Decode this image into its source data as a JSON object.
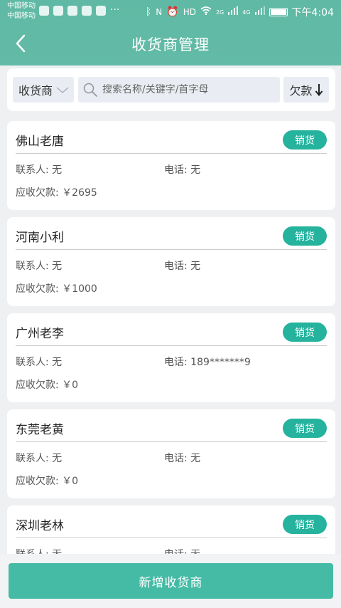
{
  "status_bar": {
    "carrier_1": "中国移动",
    "carrier_2": "中国移动",
    "hd": "HD",
    "net_2g": "2G",
    "net_4g": "4G",
    "time": "下午4:04"
  },
  "header": {
    "title": "收货商管理"
  },
  "search": {
    "filter_label": "收货商",
    "placeholder": "搜索名称/关键字/首字母",
    "sort_label": "欠款"
  },
  "labels": {
    "contact": "联系人:",
    "phone": "电话:",
    "receivable": "应收欠款:"
  },
  "customers": [
    {
      "name": "佛山老唐",
      "action": "销货",
      "contact": "无",
      "phone": "无",
      "receivable": "￥2695"
    },
    {
      "name": "河南小利",
      "action": "销货",
      "contact": "无",
      "phone": "无",
      "receivable": "￥1000"
    },
    {
      "name": "广州老李",
      "action": "销货",
      "contact": "无",
      "phone": "189*******9",
      "receivable": "￥0"
    },
    {
      "name": "东莞老黄",
      "action": "销货",
      "contact": "无",
      "phone": "无",
      "receivable": "￥0"
    },
    {
      "name": "深圳老林",
      "action": "销货",
      "contact": "无",
      "phone": "无",
      "receivable": ""
    }
  ],
  "footer": {
    "add_label": "新增收货商"
  },
  "colors": {
    "header": "#5fb9a4",
    "accent": "#25b39e",
    "add_button": "#45bba6"
  }
}
